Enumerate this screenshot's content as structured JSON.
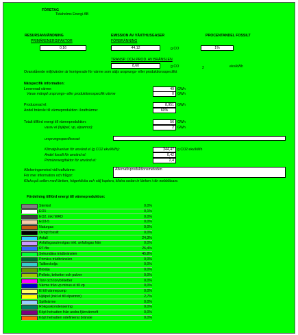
{
  "header": {
    "title": "FÖRETAG",
    "company": "Tidaholms Energi AB"
  },
  "resurs": {
    "heading": "RESURSANVÄNDNING",
    "sub": "PRIMÄRENERGIFAKTOR",
    "value": "0,16"
  },
  "emission": {
    "heading": "EMISSION AV VÄXTHUSGASER",
    "sub": "FÖRBRÄNNING",
    "value": "44,12",
    "unit": "g CO",
    "sub2": "TRANSP. OCH PROD. AV BRÄNSLEN",
    "value2": "8,60",
    "unit2": "g CO",
    "sub_2": "2",
    "unit3": "ekv/kWh"
  },
  "fossil": {
    "heading": "PROCENTANDEL FOSSILT",
    "value": "1%"
  },
  "note": "Ovanstående miljövärden är korrigerade för värme som säljs ursprungs- eller produktionsspecifikt",
  "net": {
    "heading": "Nätspecifik information:",
    "delivered_label": "Levererad värme:",
    "delivered_value": "49",
    "delivered_unit": "GWh",
    "sold_label": "Varav mängd ursprungs- eller produktionsspecifik värme",
    "sold_value": "0",
    "sold_unit": "GWh",
    "el_label": "Producerad el:",
    "el_value": "8,951",
    "el_unit": "GWh",
    "share_label": "Andel bränsle till värmeproduktion i kraftvärme:",
    "share_value": "60%"
  },
  "supplied": {
    "total_label": "Totalt tillförd energi till värmeproduktion:",
    "total_value": "56",
    "total_unit": "GWh",
    "el_label": "varav el (hjälpel, vp, elpannor):",
    "el_value": "2",
    "el_unit": "GWh",
    "spec_label": "ursprungsspecificerad:",
    "climate_label": "Klimatpåverkan för använd el (g CO2 ekv/kWh):",
    "climate_value": "344,47",
    "climate_unit": "g CO2 ekv/kWh",
    "fossil_label": "Andel fossilt för använd el:",
    "fossil_value": "0,42",
    "prim_label": "Primärenergifaktor för använd el:",
    "prim_value": "2,4"
  },
  "alloc": {
    "label": "Allokeringsmetod vid kraftvärme:",
    "value": "Alternativproduktionsmetoden",
    "info": "För mer information och frågor:",
    "hint": "Klicka på cellen med länken, högerklicka och välj kopiera, klistra sedan in länken i din webbläsare."
  },
  "distribution": {
    "heading": "Fördelning tillförd energi till värmeproduktion:",
    "rows": [
      {
        "name": "Stenkol",
        "color": "#7f7f7f",
        "pct": "0,0%"
      },
      {
        "name": "EO1",
        "color": "#ffffff",
        "pct": "0,1%"
      },
      {
        "name": "EO2, inkl WRD",
        "color": "#404040",
        "pct": "0,0%"
      },
      {
        "name": "EO3-5",
        "color": "#f4c9a8",
        "pct": "0,0%"
      },
      {
        "name": "Naturgas",
        "color": "#c45a10",
        "pct": "0,0%"
      },
      {
        "name": "Övrigt fossilt",
        "color": "#000000",
        "pct": "0,0%"
      },
      {
        "name": "Avfall",
        "color": "#33ccff",
        "pct": "24,3%"
      },
      {
        "name": "Avfallsgasutrestgas inkl. avfallsgas från",
        "color": "#cc99ff",
        "pct": "0,0%"
      },
      {
        "name": "RT-flis",
        "color": "#3366ff",
        "pct": "26,4%"
      },
      {
        "name": "Sekundära trädbränslen",
        "color": "#00ff33",
        "pct": "45,8%"
      },
      {
        "name": "Primära trädbränslen",
        "color": "#006633",
        "pct": "0,0%"
      },
      {
        "name": "Tallbeckolja",
        "color": "#33cccc",
        "pct": "0,0%"
      },
      {
        "name": "Bioolja",
        "color": "#669900",
        "pct": "0,0%"
      },
      {
        "name": "Pellets, briketter och pulver",
        "color": "#99cc00",
        "pct": "0,0%"
      },
      {
        "name": "Torv och torvbriketter",
        "color": "#ff00ff",
        "pct": "0,0%"
      },
      {
        "name": "Värme från vp minus el till vp",
        "color": "#0000cc",
        "pct": "0,0%"
      },
      {
        "name": "El till värmepump",
        "color": "#ffff66",
        "pct": "0,0%"
      },
      {
        "name": "Hjälpel (inkl el till elpannor)",
        "color": "#ffff00",
        "pct": "2,7%"
      },
      {
        "name": "Spillvärme",
        "color": "#99ccff",
        "pct": "0,0%"
      },
      {
        "name": "Rökgaskondensering",
        "color": "#008060",
        "pct": "0,0%"
      },
      {
        "name": "Köpt hetvatten från andra fjärrvärmeft",
        "color": "#7f007f",
        "pct": "0,0%"
      },
      {
        "name": "Köpt hetvatten odefinierat bränsle",
        "color": "#ff6600",
        "pct": "0,0%"
      }
    ]
  }
}
